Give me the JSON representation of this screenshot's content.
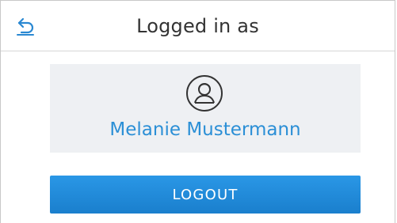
{
  "header": {
    "title": "Logged in as",
    "back_icon": "back-arrow-icon"
  },
  "user": {
    "name": "Melanie Mustermann",
    "avatar_icon": "user-avatar-icon"
  },
  "actions": {
    "logout_label": "LOGOUT"
  },
  "colors": {
    "accent": "#2b8fd6",
    "button": "#1a86d6",
    "card_bg": "#eef0f3",
    "title_text": "#333333"
  }
}
